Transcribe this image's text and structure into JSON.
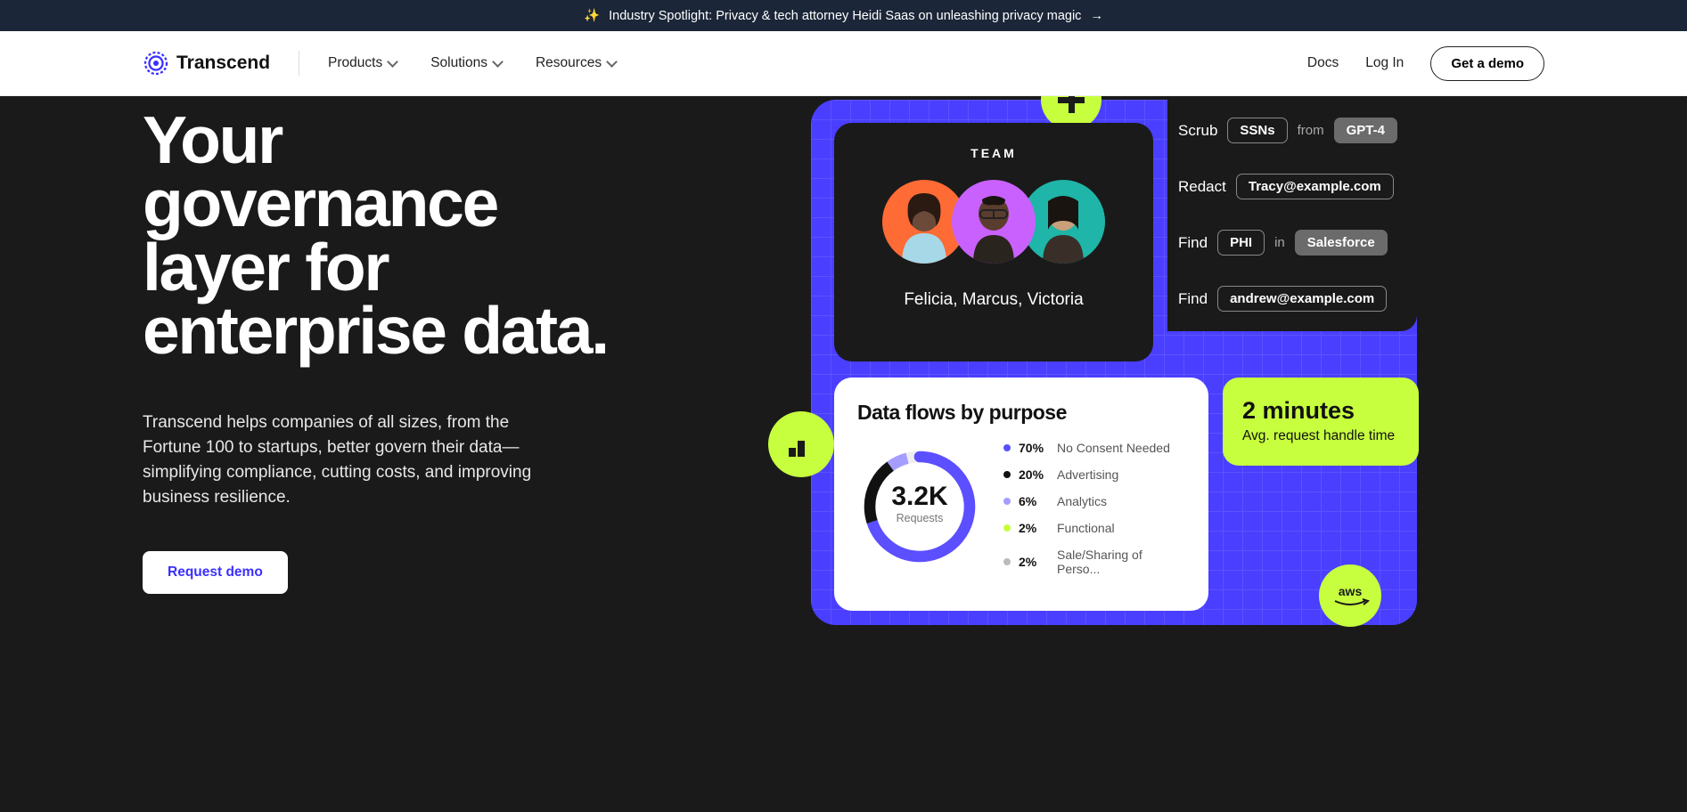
{
  "announce": {
    "text": "Industry Spotlight: Privacy & tech attorney Heidi Saas on unleashing privacy magic"
  },
  "brand": "Transcend",
  "nav": {
    "items": [
      "Products",
      "Solutions",
      "Resources"
    ],
    "docs": "Docs",
    "login": "Log In",
    "demo": "Get a demo"
  },
  "hero": {
    "headline": "Your governance layer for enterprise data.",
    "sub": "Transcend helps companies of all sizes, from the Fortune 100 to startups, better govern their data—simplifying compliance, cutting costs, and improving business resilience.",
    "cta": "Request demo"
  },
  "team": {
    "title": "TEAM",
    "names": "Felicia, Marcus, Victoria"
  },
  "rules": [
    {
      "action": "Scrub",
      "pill1": "SSNs",
      "conn": "from",
      "pill2": "GPT-4",
      "pill2_solid": true
    },
    {
      "action": "Redact",
      "pill1": "Tracy@example.com"
    },
    {
      "action": "Find",
      "pill1": "PHI",
      "conn": "in",
      "pill2": "Salesforce",
      "pill2_solid": true
    },
    {
      "action": "Find",
      "pill1": "andrew@example.com"
    }
  ],
  "flows": {
    "title": "Data flows by purpose",
    "value": "3.2K",
    "value_label": "Requests",
    "legend": [
      {
        "pct": "70%",
        "label": "No Consent Needed",
        "color": "#5b4fff"
      },
      {
        "pct": "20%",
        "label": "Advertising",
        "color": "#111"
      },
      {
        "pct": "6%",
        "label": "Analytics",
        "color": "#a59dff"
      },
      {
        "pct": "2%",
        "label": "Functional",
        "color": "#c7ff3e"
      },
      {
        "pct": "2%",
        "label": "Sale/Sharing of Perso...",
        "color": "#bbb"
      }
    ]
  },
  "stat": {
    "value": "2 minutes",
    "label": "Avg. request handle time"
  },
  "aws_label": "aws",
  "chart_data": {
    "type": "pie",
    "title": "Data flows by purpose",
    "center_value": "3.2K",
    "center_label": "Requests",
    "series": [
      {
        "name": "No Consent Needed",
        "value": 70
      },
      {
        "name": "Advertising",
        "value": 20
      },
      {
        "name": "Analytics",
        "value": 6
      },
      {
        "name": "Functional",
        "value": 2
      },
      {
        "name": "Sale/Sharing of Personal Info",
        "value": 2
      }
    ]
  }
}
